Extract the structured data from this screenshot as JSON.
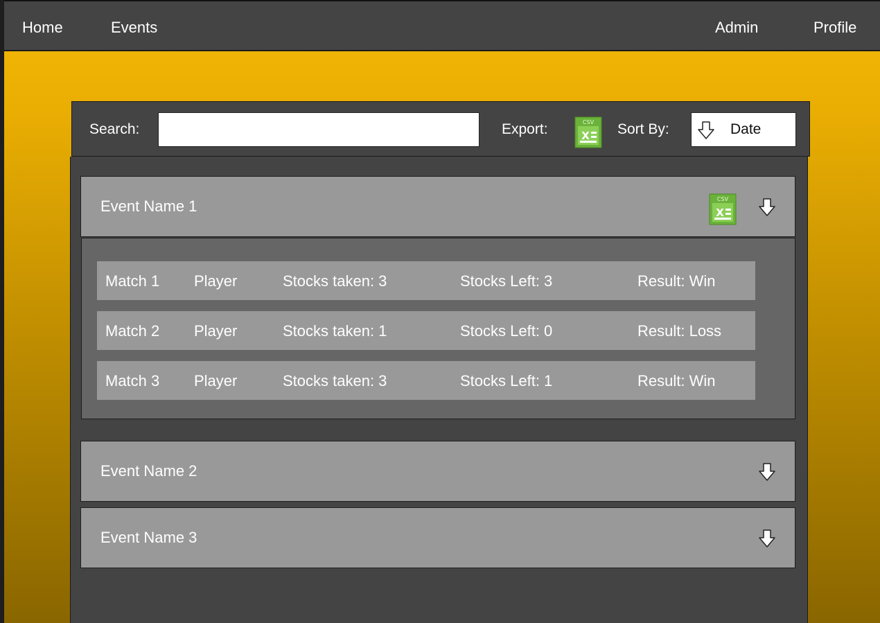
{
  "nav": {
    "home": "Home",
    "events": "Events",
    "admin": "Admin",
    "profile": "Profile"
  },
  "toolbar": {
    "search_label": "Search:",
    "search_value": "",
    "search_placeholder": "",
    "export_label": "Export:",
    "export_icon": "csv-file-icon",
    "sort_label": "Sort By:",
    "sort_value": "Date",
    "sort_icon": "down-arrow-icon"
  },
  "events": [
    {
      "name": "Event Name 1",
      "expanded": true,
      "export_icon": "csv-file-icon",
      "matches": [
        {
          "match": "Match 1",
          "player": "Player",
          "stocks_taken": "Stocks taken: 3",
          "stocks_left": "Stocks Left: 3",
          "result": "Result: Win"
        },
        {
          "match": "Match 2",
          "player": "Player",
          "stocks_taken": "Stocks taken: 1",
          "stocks_left": "Stocks Left: 0",
          "result": "Result: Loss"
        },
        {
          "match": "Match 3",
          "player": "Player",
          "stocks_taken": "Stocks taken: 3",
          "stocks_left": "Stocks Left: 1",
          "result": "Result: Win"
        }
      ]
    },
    {
      "name": "Event Name 2",
      "expanded": false
    },
    {
      "name": "Event Name 3",
      "expanded": false
    }
  ],
  "colors": {
    "nav_bg": "#444444",
    "accent_gold": "#f4b907",
    "csv_green": "#6ab23a",
    "row_bg": "#999999",
    "details_bg": "#666666"
  }
}
